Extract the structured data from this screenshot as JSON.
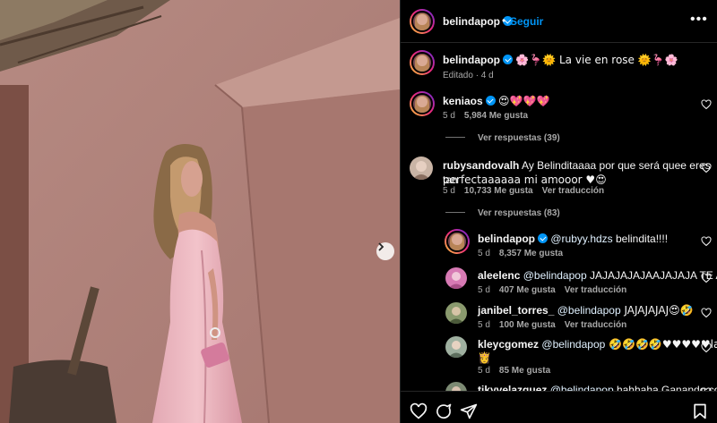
{
  "post": {
    "username": "belindapop",
    "follow_label": "Seguir",
    "dot": "•",
    "more": "•••",
    "caption": {
      "username": "belindapop",
      "text": "🌸🦩🌞 La vie en rose 🌞🦩🌸",
      "edited": "Editado · 4 d"
    }
  },
  "comments": [
    {
      "username": "keniaos",
      "text": "😍💖💖💖",
      "time": "5 d",
      "likes": "5,984 Me gusta",
      "avatar_color": "#c7b7b0"
    },
    {
      "replies_label": "Ver respuestas (39)"
    },
    {
      "username": "rubysandovalh",
      "text_line1": "Ay Belinditaaaa por que será quee eres tan",
      "text_line2": "perfectaaaaaa mi amooor ♥😍",
      "time": "5 d",
      "likes": "10,733 Me gusta",
      "translate": "Ver traducción",
      "avatar_color": "#c9b4a5"
    },
    {
      "replies_label": "Ver respuestas (83)"
    }
  ],
  "replies": [
    {
      "username": "belindapop",
      "mention": "@rubyy.hdzs",
      "text": " belindita!!!!",
      "time": "5 d",
      "likes": "8,357 Me gusta"
    },
    {
      "username": "aleelenc",
      "mention": "@belindapop",
      "text": " JAJAJAJAJAAJAJAJA TE AMO",
      "time": "5 d",
      "likes": "407 Me gusta",
      "translate": "Ver traducción",
      "avatar_color": "#d77ab4"
    },
    {
      "username": "janibel_torres_",
      "mention": "@belindapop",
      "text": " JAJAJAJAJ😍🤣",
      "time": "5 d",
      "likes": "100 Me gusta",
      "translate": "Ver traducción",
      "avatar_color": "#8a9a6e"
    },
    {
      "username": "kleycgomez",
      "mention": "@belindapop",
      "text_line1": " 🤣🤣🤣🤣♥♥♥♥♥la más",
      "text_line2": "👸",
      "time": "5 d",
      "likes": "85 Me gusta",
      "avatar_color": "#9fb0a0"
    },
    {
      "username": "tikyvelazquez",
      "mention": "@belindapop",
      "text": " hahhaha Ganando como",
      "avatar_color": "#7c8a73"
    }
  ],
  "colors": {
    "accent": "#0095f6",
    "muted": "#a8a8a8",
    "border": "#262626"
  },
  "icons": {
    "heart": "heart-icon",
    "comment": "comment-icon",
    "share": "paper-plane-icon",
    "save": "bookmark-icon",
    "next": "chevron-right-icon"
  }
}
